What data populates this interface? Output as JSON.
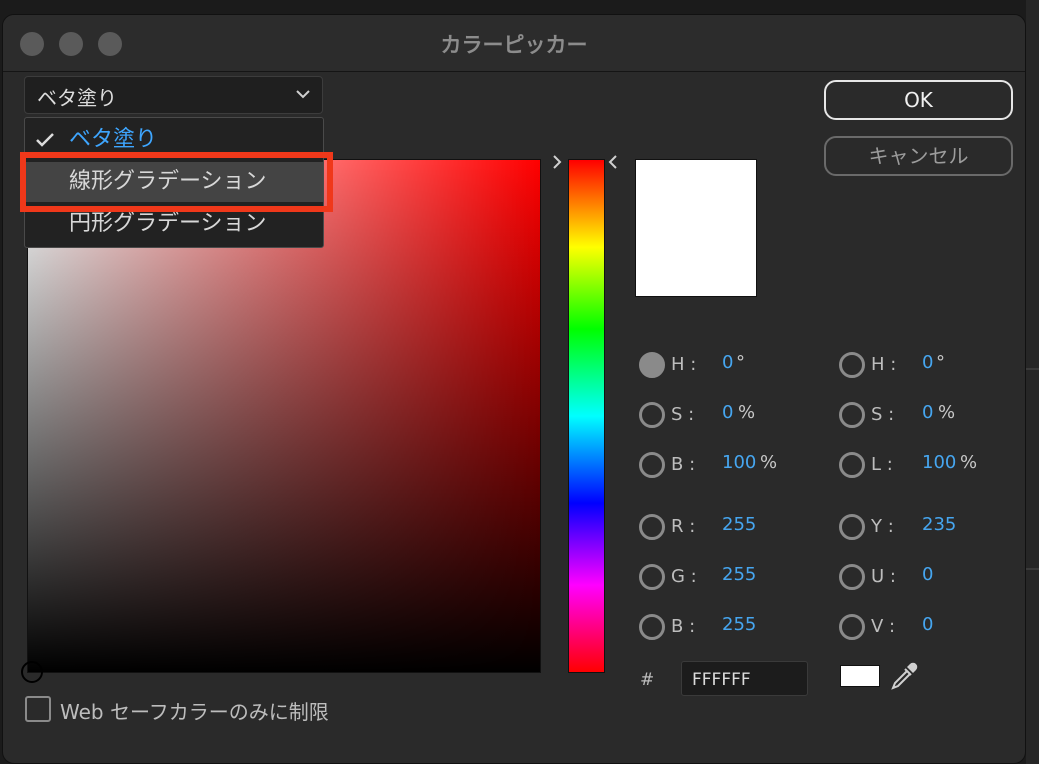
{
  "window": {
    "title": "カラーピッカー"
  },
  "fill_type": {
    "selected": "ベタ塗り",
    "options": [
      "ベタ塗り",
      "線形グラデーション",
      "円形グラデーション"
    ],
    "highlighted": "線形グラデーション"
  },
  "buttons": {
    "ok": "OK",
    "cancel": "キャンセル"
  },
  "hsb": {
    "h": {
      "label": "H :",
      "value": "0",
      "unit": "°"
    },
    "s": {
      "label": "S :",
      "value": "0",
      "unit": "%"
    },
    "b": {
      "label": "B :",
      "value": "100",
      "unit": "%"
    }
  },
  "hsl": {
    "h": {
      "label": "H :",
      "value": "0",
      "unit": "°"
    },
    "s": {
      "label": "S :",
      "value": "0",
      "unit": "%"
    },
    "l": {
      "label": "L :",
      "value": "100",
      "unit": "%"
    }
  },
  "rgb": {
    "r": {
      "label": "R :",
      "value": "255"
    },
    "g": {
      "label": "G :",
      "value": "255"
    },
    "b": {
      "label": "B :",
      "value": "255"
    }
  },
  "yuv": {
    "y": {
      "label": "Y :",
      "value": "235"
    },
    "u": {
      "label": "U :",
      "value": "0"
    },
    "v": {
      "label": "V :",
      "value": "0"
    }
  },
  "hex": {
    "label": "#",
    "value": "FFFFFF"
  },
  "websafe_label": "Web セーフカラーのみに制限",
  "colors": {
    "current": "#FFFFFF",
    "accent": "#46A6F0",
    "highlight_frame": "#F0381A"
  }
}
